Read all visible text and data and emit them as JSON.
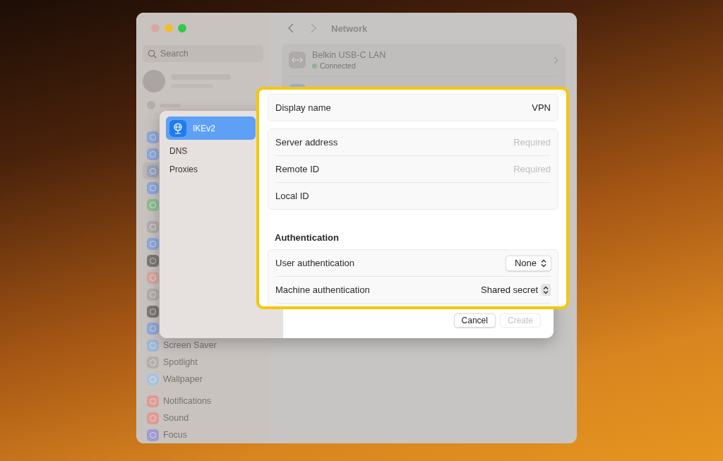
{
  "sidebar": {
    "search": {
      "placeholder": "Search"
    },
    "items": [
      {
        "color": "#8fa9d8",
        "selected": false
      },
      {
        "color": "#8fa9d8",
        "selected": false
      },
      {
        "color": "#9aa6bd",
        "selected": true
      },
      {
        "color": "#8fa9d8",
        "selected": false
      },
      {
        "color": "#8fbf92",
        "selected": false
      },
      {
        "color": "#b3aeab",
        "selected": false,
        "gap": true
      },
      {
        "color": "#8fa9d8",
        "selected": false
      },
      {
        "color": "#7c7876",
        "selected": false
      },
      {
        "color": "#d4a9a0",
        "selected": false
      },
      {
        "color": "#b3aeab",
        "selected": false
      },
      {
        "color": "#7c7876",
        "selected": false
      },
      {
        "color": "#8fa9d8",
        "selected": false
      },
      {
        "color": "#9fb7d6",
        "selected": false,
        "label": "Screen Saver"
      },
      {
        "color": "#b3aeab",
        "selected": false,
        "label": "Spotlight"
      },
      {
        "color": "#a9c2dc",
        "selected": false,
        "label": "Wallpaper"
      },
      {
        "color": "#de9a94",
        "selected": false,
        "label": "Notifications",
        "gap": true
      },
      {
        "color": "#de9a94",
        "selected": false,
        "label": "Sound"
      },
      {
        "color": "#9e9bd0",
        "selected": false,
        "label": "Focus"
      }
    ]
  },
  "header": {
    "title": "Network"
  },
  "network_services": [
    {
      "name": "Belkin USB-C LAN",
      "status": "Connected",
      "color": "#8fb48f"
    }
  ],
  "dialog": {
    "sidebar": [
      {
        "label": "IKEv2",
        "selected": true
      },
      {
        "label": "DNS",
        "selected": false
      },
      {
        "label": "Proxies",
        "selected": false
      }
    ],
    "buttons": [
      {
        "label": "Cancel",
        "disabled": false
      },
      {
        "label": "Create",
        "disabled": true
      }
    ]
  },
  "highlight": {
    "groups": [
      {
        "rows": [
          {
            "kind": "text",
            "label": "Display name",
            "value": "VPN"
          }
        ]
      },
      {
        "rows": [
          {
            "kind": "field",
            "label": "Server address",
            "placeholder": "Required"
          },
          {
            "kind": "field",
            "label": "Remote ID",
            "placeholder": "Required"
          },
          {
            "kind": "label",
            "label": "Local ID"
          }
        ]
      }
    ],
    "section_title": "Authentication",
    "auth_rows": [
      {
        "kind": "popup",
        "label": "User authentication",
        "value": "None"
      },
      {
        "kind": "stepper",
        "label": "Machine authentication",
        "value": "Shared secret"
      }
    ]
  }
}
